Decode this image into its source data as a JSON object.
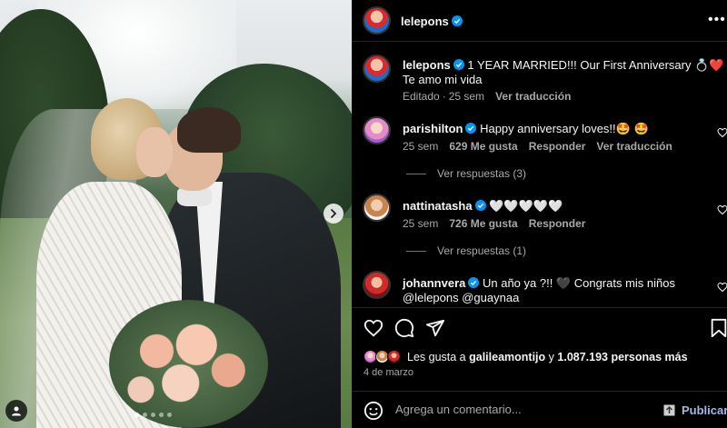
{
  "post": {
    "username": "lelepons",
    "carousel_dots": 5,
    "active_dot": 1
  },
  "caption": {
    "username": "lelepons",
    "text_line1": "1 YEAR MARRIED!!! Our First Anniversary 💍❤️",
    "text_line2": "Te amo mi vida",
    "edited": "Editado",
    "sep": "·",
    "time": "25 sem",
    "translate": "Ver traducción"
  },
  "comments": [
    {
      "username": "parishilton",
      "text": "Happy anniversary loves!!🤩 🤩",
      "time": "25 sem",
      "likes": "629 Me gusta",
      "reply": "Responder",
      "translate": "Ver traducción",
      "replies": "Ver respuestas (3)"
    },
    {
      "username": "nattinatasha",
      "text": "🤍🤍🤍🤍🤍",
      "time": "25 sem",
      "likes": "726 Me gusta",
      "reply": "Responder",
      "replies": "Ver respuestas (1)"
    },
    {
      "username": "johannvera",
      "text": "Un año ya ?!! 🖤 Congrats mis niños",
      "text_line2": "@lelepons @guaynaa"
    }
  ],
  "likes": {
    "prefix": "Les gusta a",
    "user": "galileamontijo",
    "middle": "y",
    "count": "1.087.193 personas más"
  },
  "date": "4 de marzo",
  "comment_box": {
    "placeholder": "Agrega un comentario...",
    "publish": "Publicar"
  },
  "icons": {
    "more": "more-options-icon",
    "like": "heart-icon",
    "comment": "comment-icon",
    "share": "share-icon",
    "save": "bookmark-icon",
    "emoji": "emoji-icon",
    "next": "chevron-right-icon",
    "tag": "user-tag-icon"
  },
  "colors": {
    "background": "#000000",
    "text": "#f5f5f5",
    "secondary": "#a8a8a8",
    "verified": "#0095f6",
    "publish": "#a0b9e8"
  }
}
